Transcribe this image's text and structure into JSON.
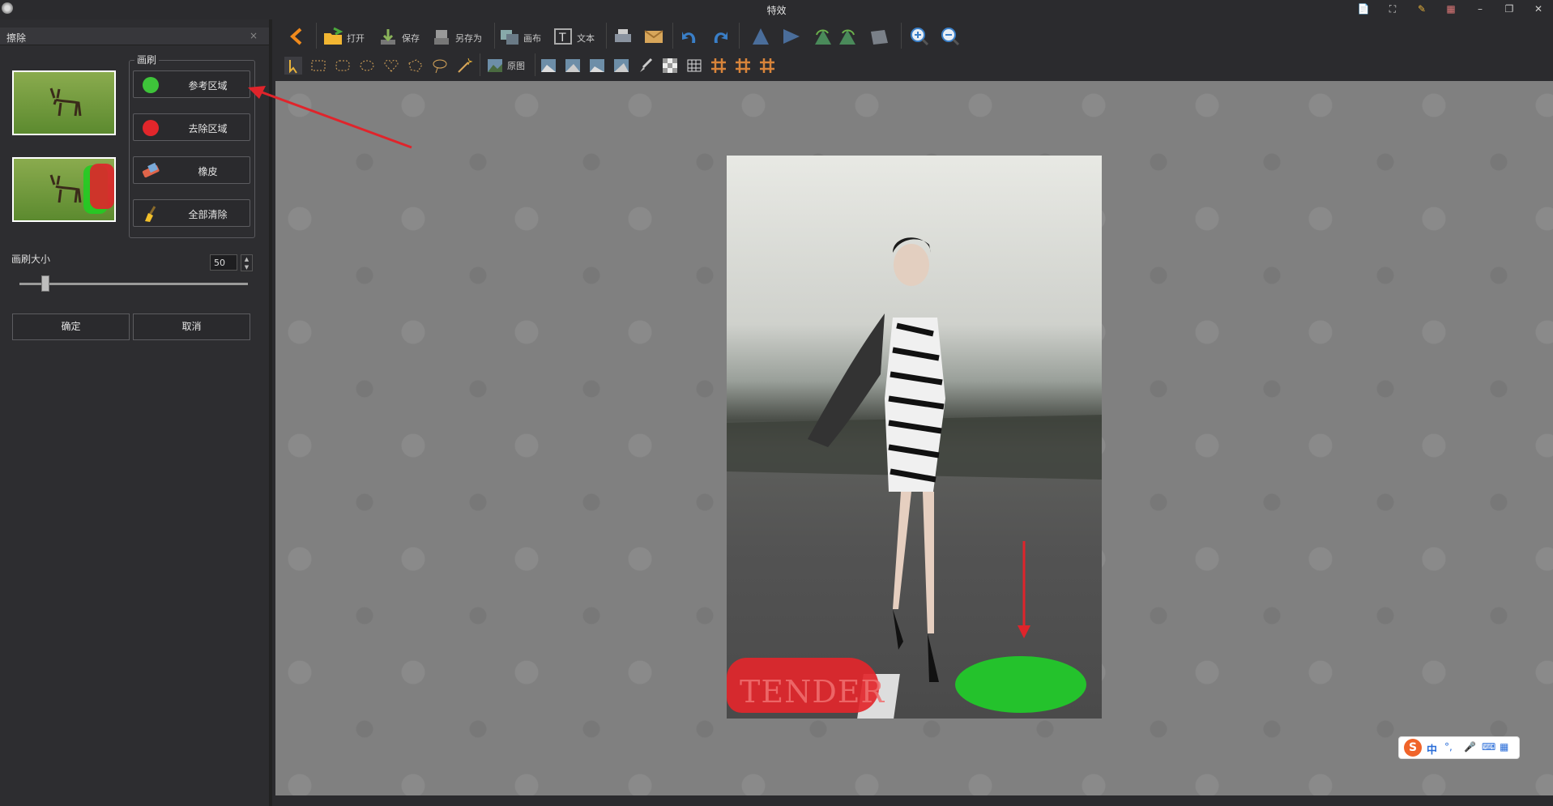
{
  "window": {
    "title": "特效",
    "controls": [
      "📄",
      "⛶",
      "✎",
      "▦",
      "–",
      "❐",
      "✕"
    ]
  },
  "panel": {
    "title": "擦除",
    "close": "×",
    "brush_group_label": "画刷",
    "brushes": [
      {
        "label": "参考区域",
        "color": "#3ec43a"
      },
      {
        "label": "去除区域",
        "color": "#e2262b"
      },
      {
        "label": "橡皮"
      },
      {
        "label": "全部清除"
      }
    ],
    "brush_size_label": "画刷大小",
    "brush_size_value": "50",
    "brush_size_slider": 0.12,
    "confirm": "确定",
    "cancel": "取消"
  },
  "toolbar": {
    "open": "打开",
    "save": "保存",
    "save_as": "另存为",
    "canvas": "画布",
    "text": "文本",
    "original": "原图"
  },
  "canvas": {
    "watermark_text": "TENDER"
  },
  "ime": {
    "lang": "中"
  }
}
